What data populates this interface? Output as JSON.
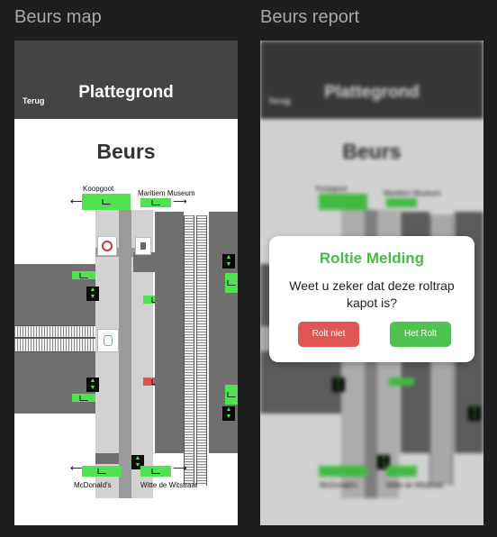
{
  "frames": {
    "map_title": "Beurs map",
    "report_title": "Beurs report"
  },
  "app": {
    "back_label": "Terug",
    "header_title": "Plattegrond",
    "station_name": "Beurs"
  },
  "map": {
    "exits": {
      "top_left": "Koopgoot",
      "top_right": "Maritiem Museum",
      "bottom_left": "McDonald's",
      "bottom_right": "Witte de Witstraat"
    },
    "colors": {
      "working": "#4fe34f",
      "broken": "#e25555"
    }
  },
  "dialog": {
    "title": "Roltie Melding",
    "message": "Weet u zeker dat deze roltrap kapot is?",
    "cancel_label": "Rolt niet",
    "confirm_label": "Het Rolt"
  }
}
